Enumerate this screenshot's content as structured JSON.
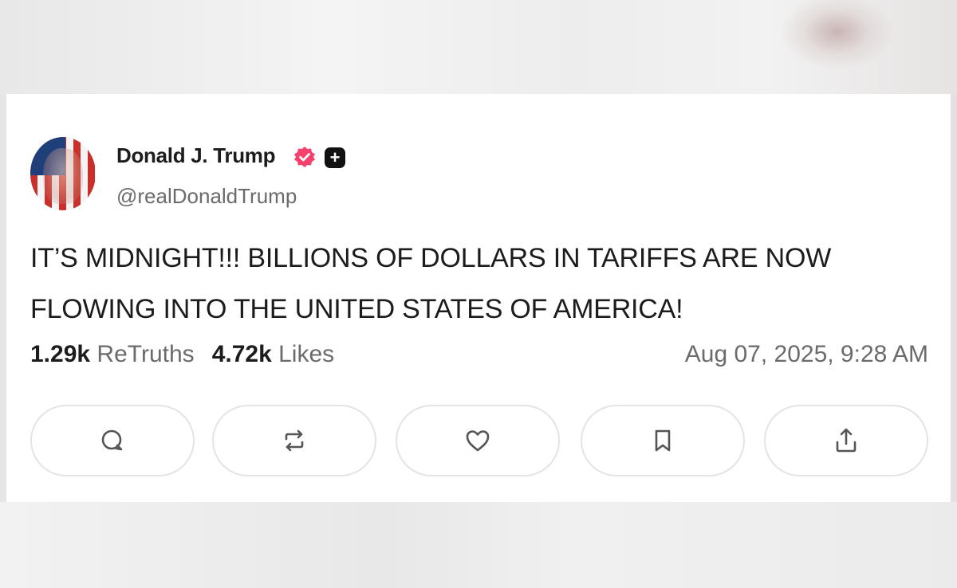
{
  "post": {
    "author": {
      "display_name": "Donald J. Trump",
      "handle": "@realDonaldTrump",
      "verified_color": "#f5426c",
      "plus_badge": "+"
    },
    "text": "IT’S MIDNIGHT!!! BILLIONS OF DOLLARS IN TARIFFS ARE NOW FLOWING INTO THE UNITED STATES OF AMERICA!",
    "stats": {
      "retruths_count": "1.29k",
      "retruths_label": "ReTruths",
      "likes_count": "4.72k",
      "likes_label": "Likes"
    },
    "timestamp": "Aug 07, 2025, 9:28 AM",
    "actions": [
      {
        "name": "reply",
        "icon": "comment-icon"
      },
      {
        "name": "retruth",
        "icon": "repost-icon"
      },
      {
        "name": "like",
        "icon": "heart-icon"
      },
      {
        "name": "bookmark",
        "icon": "bookmark-icon"
      },
      {
        "name": "share",
        "icon": "share-icon"
      }
    ]
  }
}
